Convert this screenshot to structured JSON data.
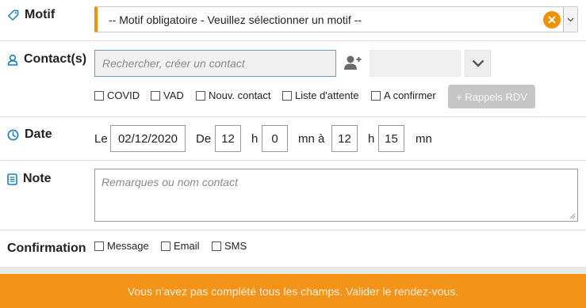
{
  "motif": {
    "label": "Motif",
    "icon": "tag-icon",
    "select_value": "-- Motif obligatoire - Veuillez sélectionner un motif --",
    "accent_color": "#f39200"
  },
  "contact": {
    "label": "Contact(s)",
    "icon": "user-icon",
    "search_placeholder": "Rechercher, créer un contact",
    "checkboxes": [
      "COVID",
      "VAD",
      "Nouv. contact",
      "Liste d'attente",
      "A confirmer"
    ],
    "rappels_button": "+ Rappels RDV"
  },
  "date": {
    "label": "Date",
    "icon": "clock-icon",
    "le": "Le",
    "date_value": "02/12/2020",
    "de": "De",
    "start_hour": "12",
    "h1": "h",
    "start_min": "0",
    "mn_a": "mn à",
    "end_hour": "12",
    "h2": "h",
    "end_min": "15",
    "mn": "mn"
  },
  "note": {
    "label": "Note",
    "icon": "note-icon",
    "placeholder": "Remarques ou nom contact"
  },
  "confirmation": {
    "label": "Confirmation",
    "options": [
      "Message",
      "Email",
      "SMS"
    ]
  },
  "footer": {
    "message": "Vous n'avez pas complété tous les champs. Valider le rendez-vous.",
    "color": "#f39318"
  }
}
